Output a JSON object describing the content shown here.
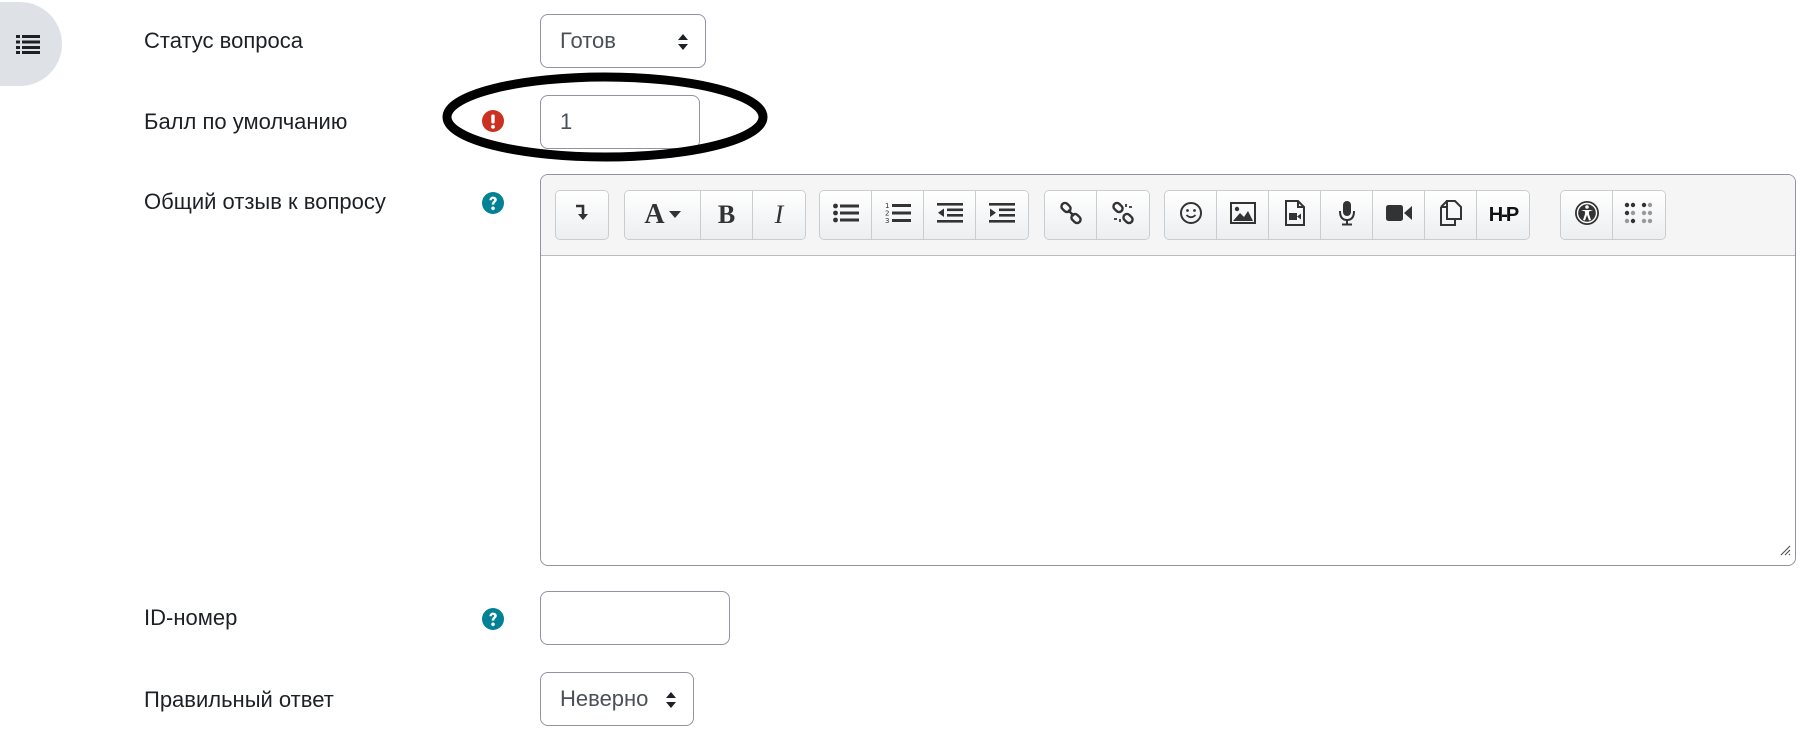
{
  "form": {
    "status": {
      "label": "Статус вопроса",
      "selected": "Готов"
    },
    "default_mark": {
      "label": "Балл по умолчанию",
      "value": "1",
      "required_icon": "exclamation-circle-icon"
    },
    "general_feedback": {
      "label": "Общий отзыв к вопросу",
      "help_icon": "question-circle-icon",
      "toolbar": [
        [
          "toolbar-toggle-icon"
        ],
        [
          "font-size-icon",
          "bold-icon",
          "italic-icon"
        ],
        [
          "unordered-list-icon",
          "ordered-list-icon",
          "outdent-icon",
          "indent-icon"
        ],
        [
          "link-icon",
          "unlink-icon"
        ],
        [
          "emoji-icon",
          "image-icon",
          "media-icon",
          "record-audio-icon",
          "record-video-icon",
          "manage-files-icon",
          "h5p-icon"
        ],
        [
          "accessibility-checker-icon",
          "screenreader-helper-icon"
        ]
      ],
      "bold_glyph": "B",
      "italic_glyph": "I",
      "font_glyph": "A",
      "h5p_glyph": "H-P",
      "content": ""
    },
    "id_number": {
      "label": "ID-номер",
      "value": ""
    },
    "correct_answer": {
      "label": "Правильный ответ",
      "selected": "Неверно"
    }
  },
  "colors": {
    "help": "#0f6cbf",
    "help_teal": "#008196",
    "required": "#ca3120",
    "annotation": "#000000"
  }
}
